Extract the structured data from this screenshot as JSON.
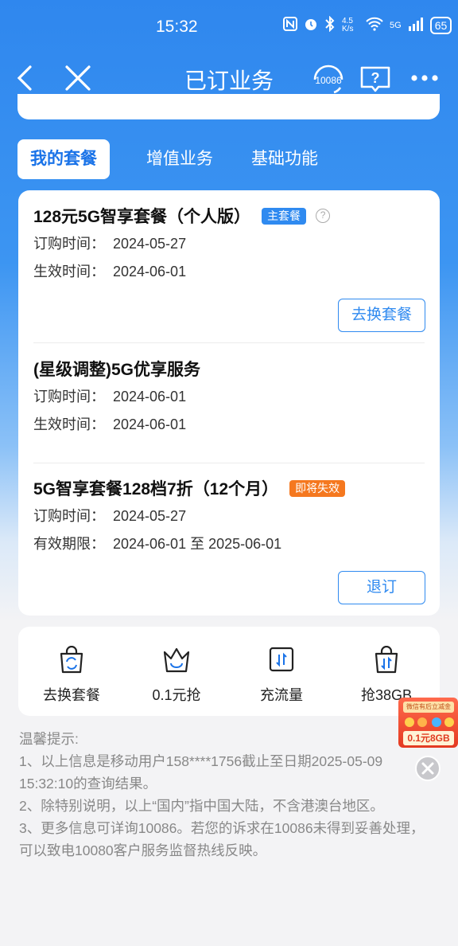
{
  "status_bar": {
    "time": "15:32",
    "net_speed": "4.5 K/s",
    "signal": "5G",
    "battery": "65"
  },
  "nav": {
    "title": "已订业务",
    "service_label": "10086"
  },
  "tabs": [
    {
      "label": "我的套餐",
      "active": true
    },
    {
      "label": "增值业务",
      "active": false
    },
    {
      "label": "基础功能",
      "active": false
    }
  ],
  "packages": [
    {
      "name": "128元5G智享套餐（个人版）",
      "badge": "主套餐",
      "rows": [
        {
          "key": "订购时间：",
          "value": "2024-05-27"
        },
        {
          "key": "生效时间：",
          "value": "2024-06-01"
        }
      ],
      "action": "去换套餐"
    },
    {
      "name": "(星级调整)5G优享服务",
      "rows": [
        {
          "key": "订购时间：",
          "value": "2024-06-01"
        },
        {
          "key": "生效时间：",
          "value": "2024-06-01"
        }
      ]
    },
    {
      "name": "5G智享套餐128档7折（12个月）",
      "badge": "即将失效",
      "rows": [
        {
          "key": "订购时间：",
          "value": "2024-05-27"
        },
        {
          "key": "有效期限：",
          "value": "2024-06-01 至 2025-06-01"
        }
      ],
      "action": "退订"
    }
  ],
  "quick_actions": [
    {
      "label": "去换套餐",
      "icon": "bag-swap-icon"
    },
    {
      "label": "0.1元抢",
      "icon": "crown-basket-icon"
    },
    {
      "label": "充流量",
      "icon": "data-transfer-icon"
    },
    {
      "label": "抢38GB",
      "icon": "bag-data-icon"
    }
  ],
  "tips": {
    "title": "温馨提示:",
    "line1": "1、以上信息是移动用户158****1756截止至日期2025-05-09 15:32:10的查询结果。",
    "line2": "2、除特别说明，以上“国内”指中国大陆，不含港澳台地区。",
    "line3": "3、更多信息可详询10086。若您的诉求在10086未得到妥善处理，可以致电10080客户服务监督热线反映。"
  },
  "floater": {
    "top_text": "微信有后立减金",
    "price_text": "0.1元8GB"
  },
  "colors": {
    "primary": "#2f8af0",
    "warning": "#f5781f"
  }
}
